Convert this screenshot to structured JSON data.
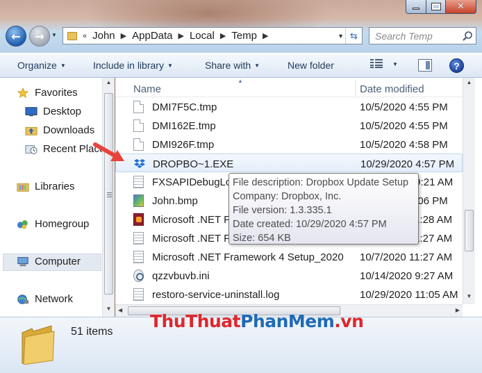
{
  "window": {
    "minimize_label": "",
    "maximize_label": "",
    "close_glyph": "✕"
  },
  "address": {
    "prefix": "«",
    "segments": [
      "John",
      "AppData",
      "Local",
      "Temp"
    ]
  },
  "search": {
    "placeholder": "Search Temp"
  },
  "toolbar": {
    "organize": "Organize",
    "include_in_library": "Include in library",
    "share_with": "Share with",
    "new_folder": "New folder",
    "help": "?"
  },
  "navpane": {
    "favorites": "Favorites",
    "desktop": "Desktop",
    "downloads": "Downloads",
    "recent_places": "Recent Places",
    "libraries": "Libraries",
    "homegroup": "Homegroup",
    "computer": "Computer",
    "network": "Network"
  },
  "columns": {
    "name": "Name",
    "date_modified": "Date modified"
  },
  "files": [
    {
      "name": "DMI7F5C.tmp",
      "date": "10/5/2020 4:55 PM",
      "icon": "doc-icon"
    },
    {
      "name": "DMI162E.tmp",
      "date": "10/5/2020 4:55 PM",
      "icon": "doc-icon"
    },
    {
      "name": "DMI926F.tmp",
      "date": "10/5/2020 4:58 PM",
      "icon": "doc-icon"
    },
    {
      "name": "DROPBO~1.EXE",
      "date": "10/29/2020 4:57 PM",
      "icon": "dropbox-icon"
    },
    {
      "name": "FXSAPIDebugLogFile.txt",
      "date": "10/21/2020 9:21 AM",
      "icon": "txt-icon"
    },
    {
      "name": "John.bmp",
      "date": "10/5/2020 5:06 PM",
      "icon": "bmp-icon"
    },
    {
      "name": "Microsoft .NET Framework 4 Setup",
      "date": "10/7/2020 11:28 AM",
      "icon": "exe-icon"
    },
    {
      "name": "Microsoft .NET Framework 4 Setup",
      "date": "10/7/2020 11:27 AM",
      "icon": "txt-icon"
    },
    {
      "name": "Microsoft .NET Framework 4 Setup_2020...",
      "date": "10/7/2020 11:27 AM",
      "icon": "txt-icon"
    },
    {
      "name": "qzzvbuvb.ini",
      "date": "10/14/2020 9:27 AM",
      "icon": "ini-icon"
    },
    {
      "name": "restoro-service-uninstall.log",
      "date": "10/29/2020 11:05 AM",
      "icon": "txt-icon"
    }
  ],
  "tooltip": {
    "description": "File description: Dropbox Update Setup",
    "company": "Company: Dropbox, Inc.",
    "version": "File version: 1.3.335.1",
    "created": "Date created: 10/29/2020 4:57 PM",
    "size": "Size: 654 KB"
  },
  "details": {
    "count": "51 items",
    "watermark_a": "ThuThuat",
    "watermark_b": "PhanMem",
    "watermark_c": ".vn"
  },
  "colors": {
    "accent": "#1f6ab5",
    "annotation_arrow": "#e8433a",
    "watermark_red": "#e0262c"
  }
}
